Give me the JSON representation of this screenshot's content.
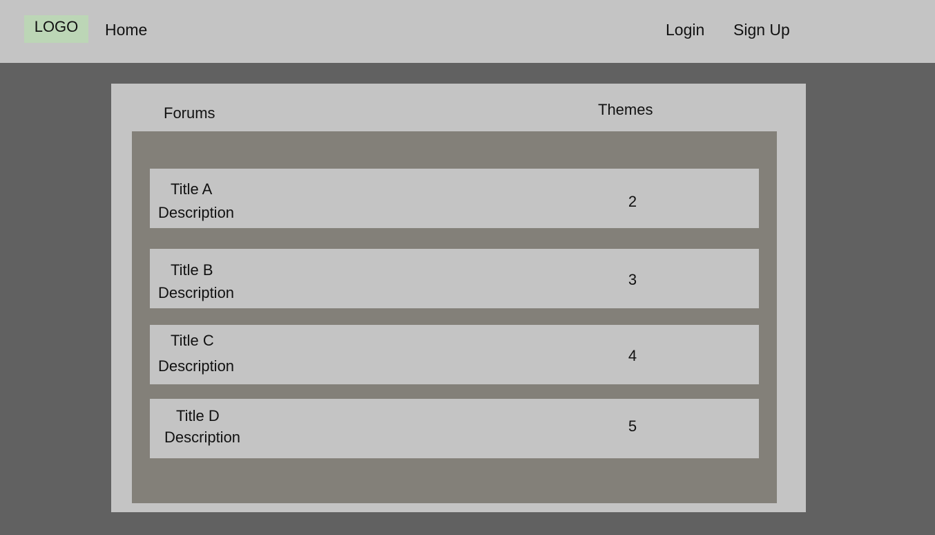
{
  "header": {
    "logo_text": "LOGO",
    "logo_color": "#bcd6b6",
    "nav": {
      "home": "Home",
      "login": "Login",
      "signup": "Sign Up"
    }
  },
  "forums_table": {
    "columns": {
      "forums": "Forums",
      "themes": "Themes"
    },
    "rows": [
      {
        "title": "Title A",
        "description": "Description",
        "themes": "2"
      },
      {
        "title": "Title B",
        "description": "Description",
        "themes": "3"
      },
      {
        "title": "Title C",
        "description": "Description",
        "themes": "4"
      },
      {
        "title": "Title D",
        "description": "Description",
        "themes": "5"
      }
    ]
  },
  "colors": {
    "page_background": "#616161",
    "bar_and_panel": "#c4c4c4",
    "list_background": "#838079"
  }
}
